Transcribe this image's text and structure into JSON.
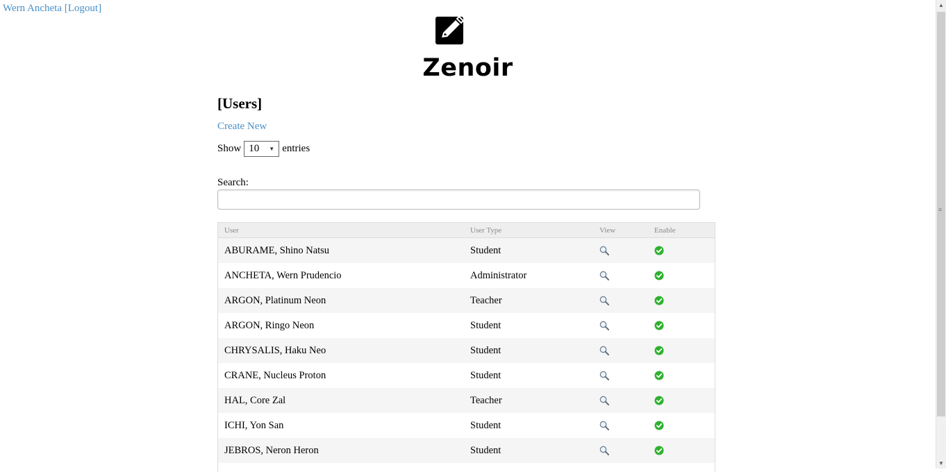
{
  "header": {
    "user_link": "Wern Ancheta [Logout]",
    "app_title": "Zenoir",
    "logo_icon": "edit-square-icon"
  },
  "page": {
    "heading": "[Users]",
    "create_link": "Create New",
    "length": {
      "show": "Show",
      "selected": "10",
      "entries": "entries"
    },
    "search_label": "Search:",
    "search_value": ""
  },
  "table": {
    "columns": [
      "User",
      "User Type",
      "View",
      "Enable"
    ],
    "rows": [
      {
        "user": "ABURAME, Shino Natsu",
        "type": "Student"
      },
      {
        "user": "ANCHETA, Wern Prudencio",
        "type": "Administrator"
      },
      {
        "user": "ARGON, Platinum Neon",
        "type": "Teacher"
      },
      {
        "user": "ARGON, Ringo Neon",
        "type": "Student"
      },
      {
        "user": "CHRYSALIS, Haku Neo",
        "type": "Student"
      },
      {
        "user": "CRANE, Nucleus Proton",
        "type": "Student"
      },
      {
        "user": "HAL, Core Zal",
        "type": "Teacher"
      },
      {
        "user": "ICHI, Yon San",
        "type": "Student"
      },
      {
        "user": "JEBROS, Neron Heron",
        "type": "Student"
      }
    ],
    "view_icon": "magnifier-icon",
    "enable_icon": "green-check-icon"
  },
  "colors": {
    "link": "#4a90c8",
    "enable": "#2fb12f",
    "row_alt": "#f5f5f5"
  }
}
